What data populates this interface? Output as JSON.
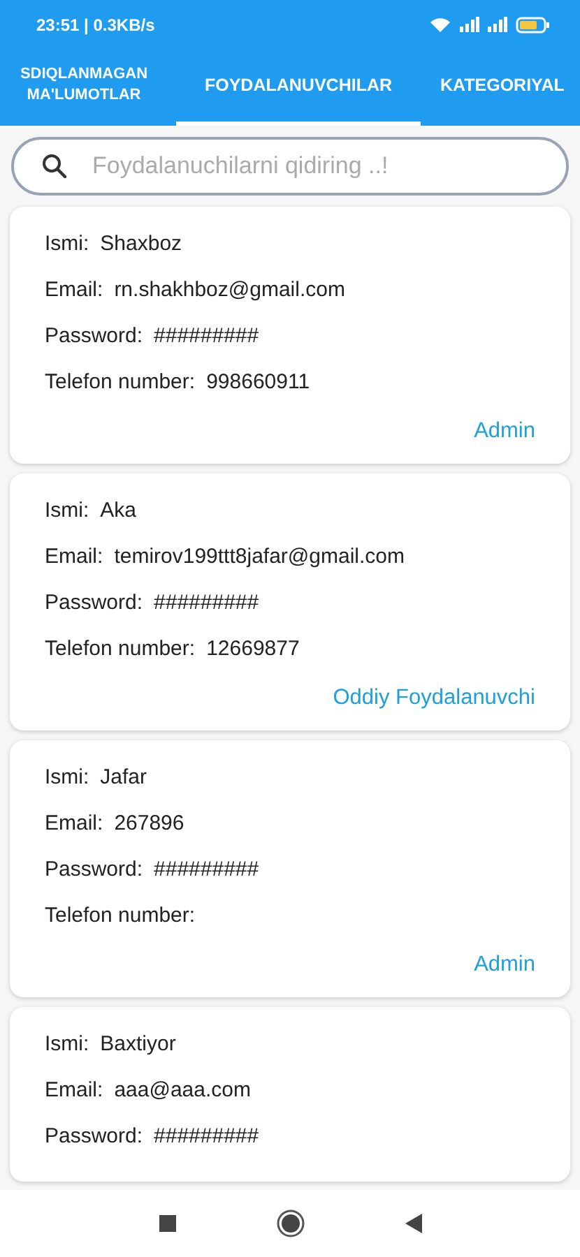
{
  "status_bar": {
    "time": "23:51 | 0.3KB/s"
  },
  "tabs": [
    {
      "label": "SDIQLANMAGAN MA'LUMOTLAR",
      "selected": false
    },
    {
      "label": "FOYDALANUVCHILAR",
      "selected": true
    },
    {
      "label": "KATEGORIYAL",
      "selected": false
    }
  ],
  "search": {
    "placeholder": "Foydalanuchilarni qidiring ..!"
  },
  "users": [
    {
      "fields": [
        {
          "label": "Ismi:",
          "value": "Shaxboz"
        },
        {
          "label": "Email:",
          "value": "rn.shakhboz@gmail.com"
        },
        {
          "label": "Password:",
          "value": "#########"
        },
        {
          "label": "Telefon number:",
          "value": "998660911"
        }
      ],
      "role": "Admin"
    },
    {
      "fields": [
        {
          "label": "Ismi:",
          "value": "Aka"
        },
        {
          "label": "Email:",
          "value": "temirov199ttt8jafar@gmail.com"
        },
        {
          "label": "Password:",
          "value": "#########"
        },
        {
          "label": "Telefon number:",
          "value": "12669877"
        }
      ],
      "role": "Oddiy Foydalanuvchi"
    },
    {
      "fields": [
        {
          "label": "Ismi:",
          "value": "Jafar"
        },
        {
          "label": "Email:",
          "value": "267896"
        },
        {
          "label": "Password:",
          "value": "#########"
        },
        {
          "label": "Telefon number:"
        }
      ],
      "role": "Admin"
    },
    {
      "fields": [
        {
          "label": "Ismi:",
          "value": "Baxtiyor"
        },
        {
          "label": "Email:",
          "value": "aaa@aaa.com"
        },
        {
          "label": "Password:",
          "value": "#########"
        }
      ]
    }
  ]
}
